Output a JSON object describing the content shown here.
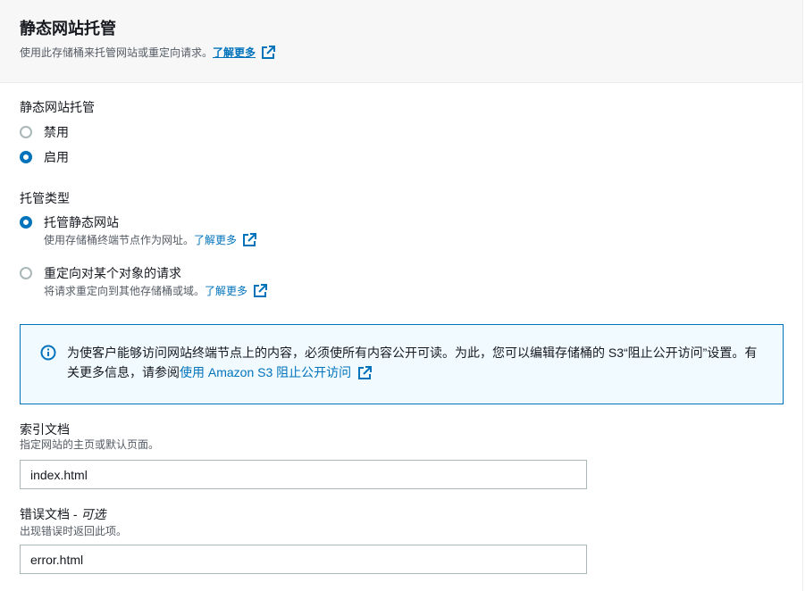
{
  "header": {
    "title": "静态网站托管",
    "description": "使用此存储桶来托管网站或重定向请求。",
    "learn_more": "了解更多"
  },
  "hosting": {
    "label": "静态网站托管",
    "options": [
      {
        "label": "禁用",
        "checked": false
      },
      {
        "label": "启用",
        "checked": true
      }
    ]
  },
  "hosting_type": {
    "label": "托管类型",
    "options": [
      {
        "label": "托管静态网站",
        "description": "使用存储桶终端节点作为网址。",
        "learn_more": "了解更多",
        "checked": true
      },
      {
        "label": "重定向对某个对象的请求",
        "description": "将请求重定向到其他存储桶或域。",
        "learn_more": "了解更多",
        "checked": false
      }
    ]
  },
  "info": {
    "text": "为使客户能够访问网站终端节点上的内容，必须使所有内容公开可读。为此，您可以编辑存储桶的 S3“阻止公开访问”设置。有关更多信息，请参阅",
    "link": "使用 Amazon S3 阻止公开访问"
  },
  "index_document": {
    "label": "索引文档",
    "description": "指定网站的主页或默认页面。",
    "value": "index.html"
  },
  "error_document": {
    "label": "错误文档",
    "optional_label": "可选",
    "separator": " - ",
    "description": "出现错误时返回此项。",
    "value": "error.html"
  },
  "colors": {
    "link": "#0073bb",
    "header_bg": "#f7f7f7",
    "info_bg": "#f1faff",
    "info_border": "#0073bb"
  }
}
